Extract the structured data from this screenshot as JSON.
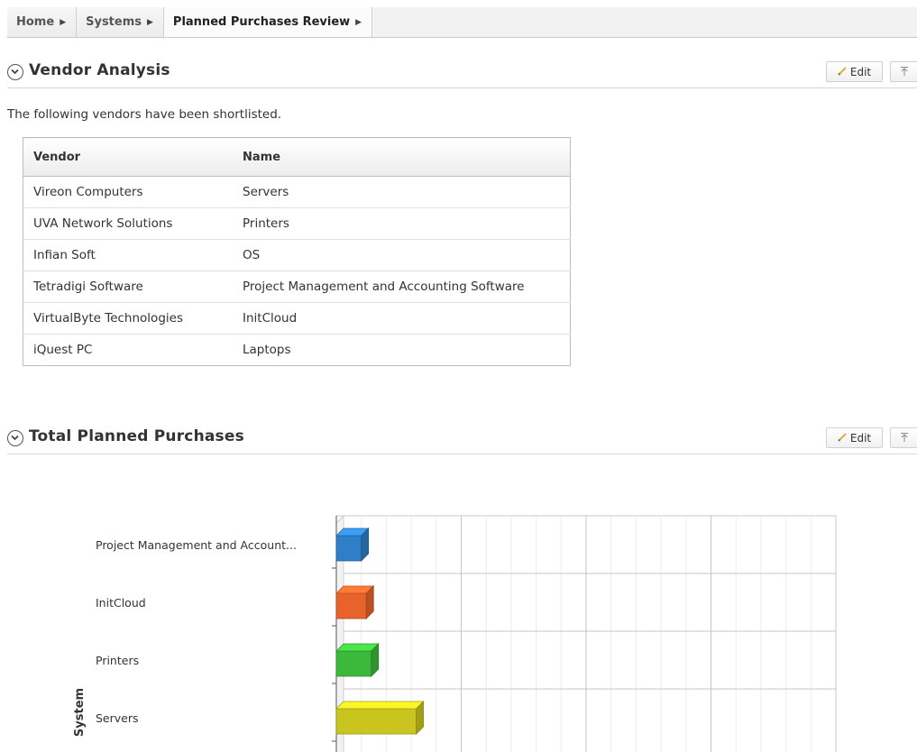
{
  "breadcrumb": [
    {
      "label": "Home"
    },
    {
      "label": "Systems"
    },
    {
      "label": "Planned Purchases Review"
    }
  ],
  "vendor_region": {
    "title": "Vendor Analysis",
    "edit_label": "Edit",
    "intro": "The following vendors have been shortlisted.",
    "columns": [
      "Vendor",
      "Name"
    ],
    "rows": [
      [
        "Vireon Computers",
        "Servers"
      ],
      [
        "UVA Network Solutions",
        "Printers"
      ],
      [
        "Infian Soft",
        "OS"
      ],
      [
        "Tetradigi Software",
        "Project Management and Accounting Software"
      ],
      [
        "VirtualByte Technologies",
        "InitCloud"
      ],
      [
        "iQuest PC",
        "Laptops"
      ]
    ]
  },
  "purchases_region": {
    "title": "Total Planned Purchases",
    "edit_label": "Edit"
  },
  "icons": {
    "collapse": "chevron-down-circle-icon",
    "edit": "pencil-icon",
    "top": "arrow-up-to-line-icon",
    "crumb_separator": "triangle-right-icon"
  },
  "chart_data": {
    "type": "bar",
    "orientation": "horizontal",
    "style": "3d",
    "ylabel": "System",
    "categories": [
      "Project Management and Account...",
      "InitCloud",
      "Printers",
      "Servers"
    ],
    "series": [
      {
        "values": [
          1,
          1.2,
          1.4,
          3.2
        ]
      }
    ],
    "colors": [
      "#2f7fc8",
      "#e8632b",
      "#3cb83a",
      "#c9c51e"
    ],
    "xlim": [
      0,
      20
    ],
    "grid": true
  }
}
